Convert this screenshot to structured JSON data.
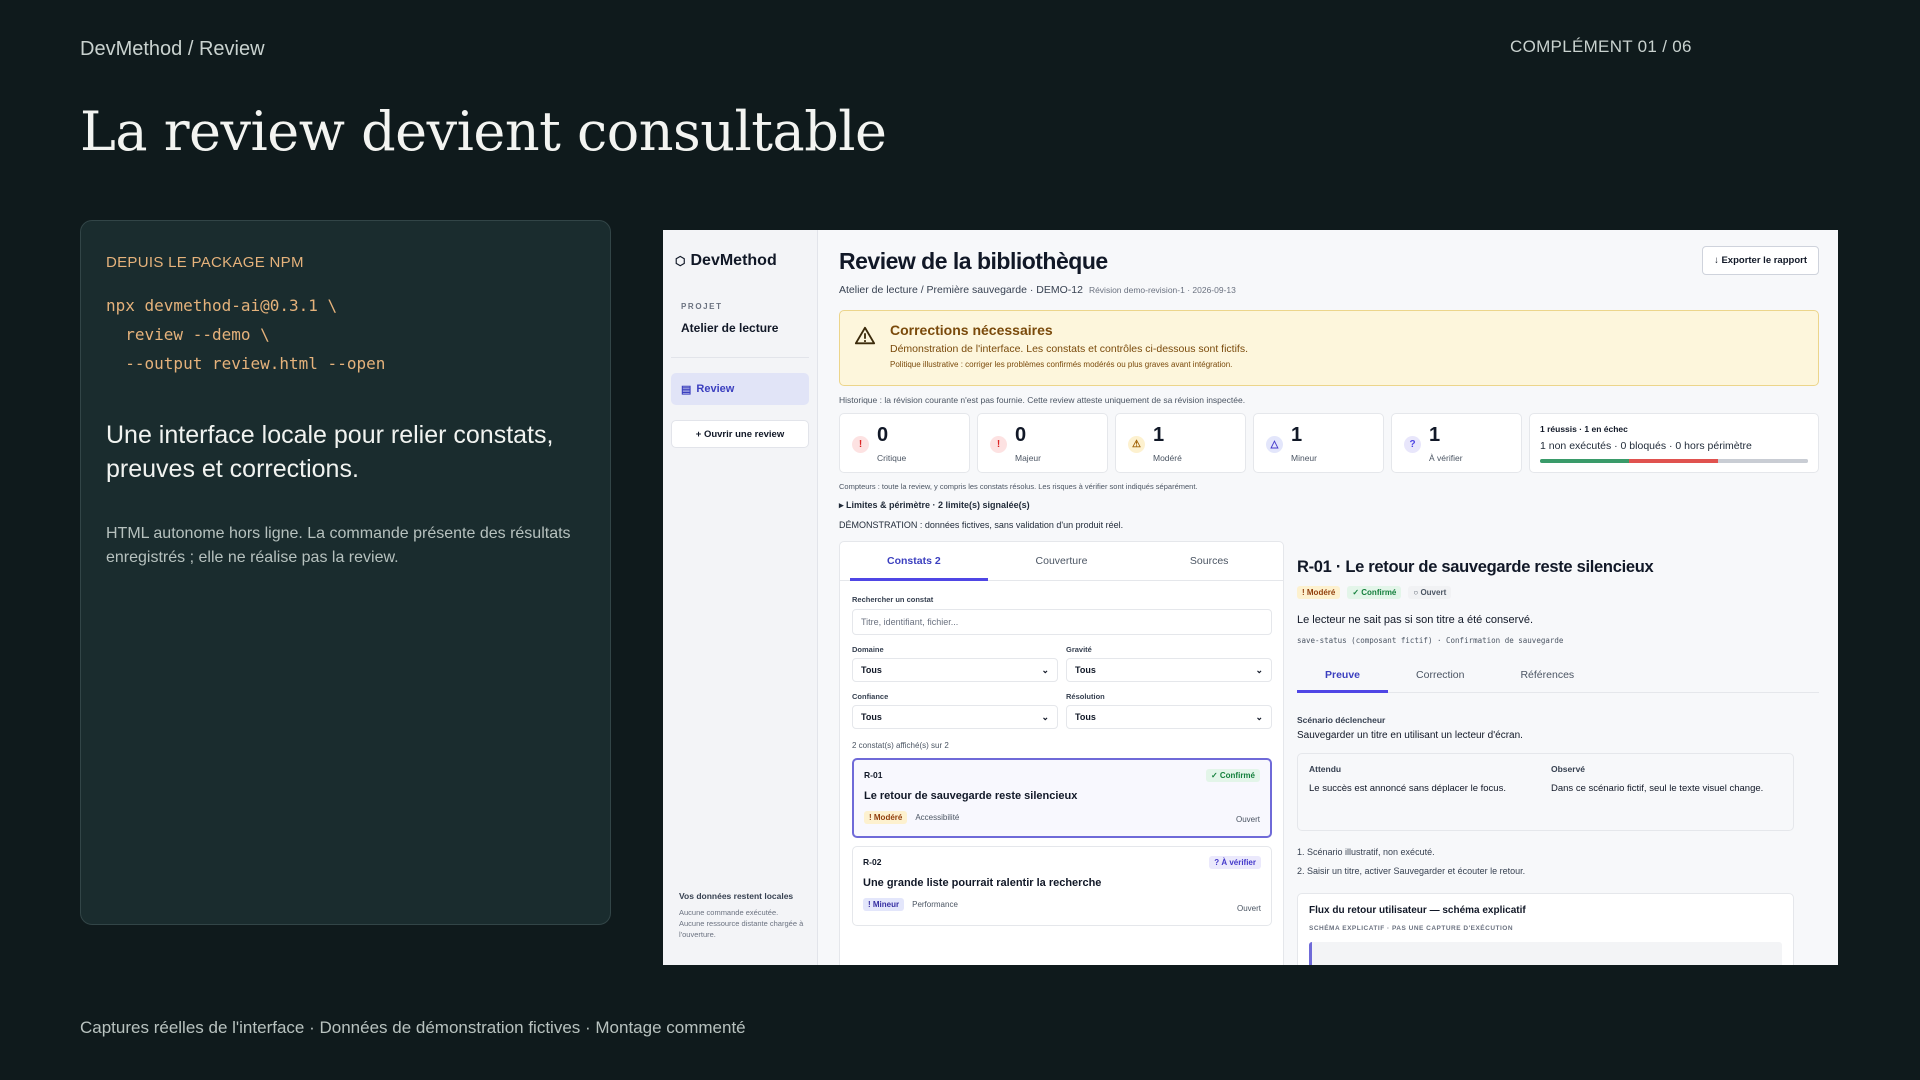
{
  "slide": {
    "breadcrumb": "DevMethod / Review",
    "counter": "COMPLÉMENT  01 / 06",
    "title": "La review devient consultable",
    "footer": "Captures réelles de l'interface · Données de démonstration fictives · Montage commenté"
  },
  "command_card": {
    "kicker": "DEPUIS LE PACKAGE NPM",
    "code_lines": [
      "npx devmethod-ai@0.3.1 \\",
      "  review --demo \\",
      "  --output review.html --open"
    ],
    "lead": "Une interface locale pour relier constats, preuves et corrections.",
    "note": "HTML autonome hors ligne. La commande présente des résultats enregistrés ; elle ne réalise pas la review."
  },
  "app": {
    "brand": "DevMethod",
    "brand_icon": "hexagon-icon",
    "sidebar": {
      "project_label": "PROJET",
      "project_name": "Atelier de lecture",
      "nav_review": "Review",
      "open_button": "+ Ouvrir une review",
      "local_title": "Vos données restent locales",
      "local_text": "Aucune commande exécutée. Aucune ressource distante chargée à l'ouverture."
    },
    "header": {
      "title": "Review de la bibliothèque",
      "export_label": "↓ Exporter le rapport",
      "meta": "Atelier de lecture / Première sauvegarde · DEMO-12",
      "meta_small": "Révision demo-revision-1 · 2026-09-13"
    },
    "alert": {
      "title": "Corrections nécessaires",
      "line": "Démonstration de l'interface. Les constats et contrôles ci-dessous sont fictifs.",
      "small": "Politique illustrative : corriger les problèmes confirmés modérés ou plus graves avant intégration.",
      "color": "#fdf6dc"
    },
    "history": "Historique : la révision courante n'est pas fournie. Cette review atteste uniquement de sa révision inspectée.",
    "stats": [
      {
        "value": "0",
        "label": "Critique",
        "icon": "!",
        "icon_name": "alert-circle-icon"
      },
      {
        "value": "0",
        "label": "Majeur",
        "icon": "!",
        "icon_name": "alert-circle-icon"
      },
      {
        "value": "1",
        "label": "Modéré",
        "icon": "⚠",
        "icon_name": "warning-triangle-icon"
      },
      {
        "value": "1",
        "label": "Mineur",
        "icon": "△",
        "icon_name": "info-triangle-icon"
      },
      {
        "value": "1",
        "label": "À vérifier",
        "icon": "?",
        "icon_name": "question-icon"
      }
    ],
    "tests": {
      "title": "1 réussis · 1 en échec",
      "summary": "1 non exécutés · 0 bloqués · 0 hors périmètre",
      "segments": [
        {
          "fraction": 0.333,
          "color": "#3a9b6a"
        },
        {
          "fraction": 0.333,
          "color": "#e0524f"
        },
        {
          "fraction": 0.334,
          "color": "#c9cdd4"
        }
      ]
    },
    "counters_note": "Compteurs : toute la review, y compris les constats résolus. Les risques à vérifier sont indiqués séparément.",
    "limits": "▸ Limites & périmètre · 2 limite(s) signalée(s)",
    "demo_note": "DÉMONSTRATION : données fictives, sans validation d'un produit réel.",
    "list": {
      "tabs": [
        "Constats 2",
        "Couverture",
        "Sources"
      ],
      "search_label": "Rechercher un constat",
      "search_placeholder": "Titre, identifiant, fichier...",
      "filters": [
        {
          "label": "Domaine",
          "value": "Tous"
        },
        {
          "label": "Gravité",
          "value": "Tous"
        },
        {
          "label": "Confiance",
          "value": "Tous"
        },
        {
          "label": "Résolution",
          "value": "Tous"
        }
      ],
      "count": "2 constat(s) affiché(s) sur 2",
      "items": [
        {
          "id": "R-01",
          "badge": "✓ Confirmé",
          "title": "Le retour de sauvegarde reste silencieux",
          "severity": "! Modéré",
          "domain": "Accessibilité",
          "status": "Ouvert"
        },
        {
          "id": "R-02",
          "badge": "? À vérifier",
          "title": "Une grande liste pourrait ralentir la recherche",
          "severity": "! Mineur",
          "domain": "Performance",
          "status": "Ouvert"
        }
      ]
    },
    "detail": {
      "title": "R-01 · Le retour de sauvegarde reste silencieux",
      "tags": [
        "! Modéré",
        "✓ Confirmé",
        "○ Ouvert"
      ],
      "description": "Le lecteur ne sait pas si son titre a été conservé.",
      "code": "save-status (composant fictif) · Confirmation de sauvegarde",
      "tabs": [
        "Preuve",
        "Correction",
        "Références"
      ],
      "scenario_label": "Scénario déclencheur",
      "scenario_text": "Sauvegarder un titre en utilisant un lecteur d'écran.",
      "expected_label": "Attendu",
      "expected_text": "Le succès est annoncé sans déplacer le focus.",
      "observed_label": "Observé",
      "observed_text": "Dans ce scénario fictif, seul le texte visuel change.",
      "steps": [
        "1. Scénario illustratif, non exécuté.",
        "2. Saisir un titre, activer Sauvegarder et écouter le retour."
      ],
      "flow_title": "Flux du retour utilisateur — schéma explicatif",
      "flow_sub": "SCHÉMA EXPLICATIF · PAS UNE CAPTURE D'EXÉCUTION"
    }
  }
}
